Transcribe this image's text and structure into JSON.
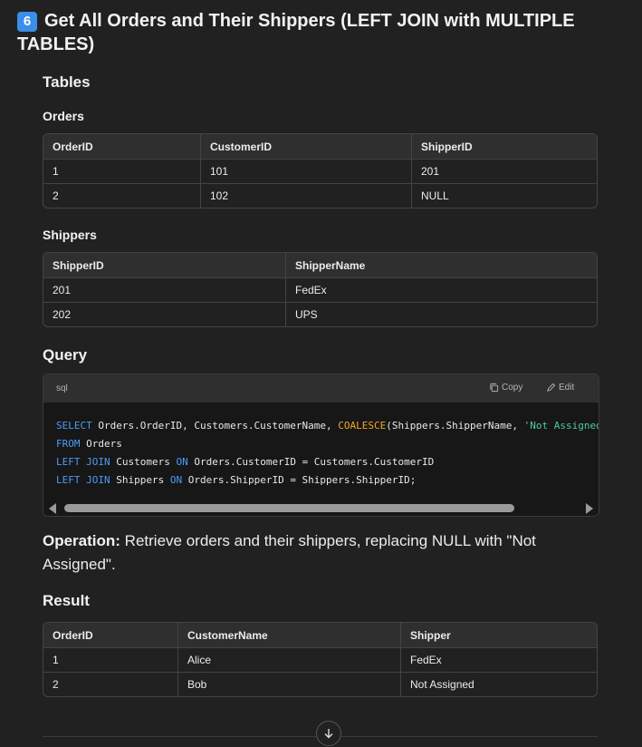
{
  "heading": {
    "badge": "6",
    "text": "Get All Orders and Their Shippers (LEFT JOIN with MULTIPLE TABLES)"
  },
  "tables_heading": "Tables",
  "orders": {
    "title": "Orders",
    "columns": [
      "OrderID",
      "CustomerID",
      "ShipperID"
    ],
    "rows": [
      [
        "1",
        "101",
        "201"
      ],
      [
        "2",
        "102",
        "NULL"
      ]
    ]
  },
  "shippers": {
    "title": "Shippers",
    "columns": [
      "ShipperID",
      "ShipperName"
    ],
    "rows": [
      [
        "201",
        "FedEx"
      ],
      [
        "202",
        "UPS"
      ]
    ]
  },
  "query_heading": "Query",
  "code": {
    "language": "sql",
    "copy_label": "Copy",
    "edit_label": "Edit",
    "lines": [
      "SELECT Orders.OrderID, Customers.CustomerName, COALESCE(Shippers.ShipperName, 'Not Assigned')",
      "FROM Orders",
      "LEFT JOIN Customers ON Orders.CustomerID = Customers.CustomerID",
      "LEFT JOIN Shippers ON Orders.ShipperID = Shippers.ShipperID;"
    ]
  },
  "operation": {
    "label": "Operation:",
    "text": " Retrieve orders and their shippers, replacing NULL with \"Not Assigned\"."
  },
  "result": {
    "title": "Result",
    "columns": [
      "OrderID",
      "CustomerName",
      "Shipper"
    ],
    "rows": [
      [
        "1",
        "Alice",
        "FedEx"
      ],
      [
        "2",
        "Bob",
        "Not Assigned"
      ]
    ]
  },
  "icons": [
    "copy-icon",
    "edit-icon",
    "scroll-down-arrow-icon"
  ]
}
